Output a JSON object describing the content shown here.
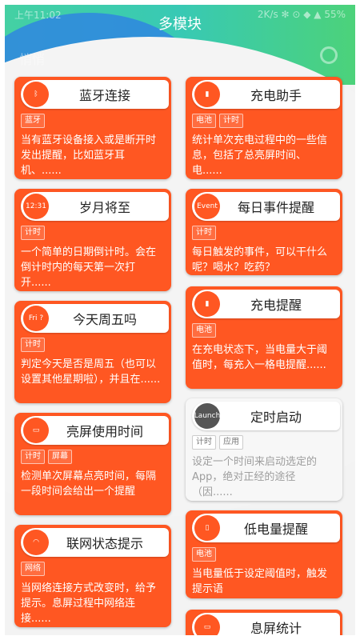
{
  "status_bar": {
    "time": "上午11:02",
    "right": "2K/s ✻ ⊙ ◆ ▲ 55%"
  },
  "header": {
    "title": "多模块",
    "subtitle": "悄悄"
  },
  "colors": {
    "card": "#ff5722",
    "header": "#3ccaa8",
    "blue_curve": "#2f86e0"
  },
  "left_cards": [
    {
      "title": "蓝牙连接",
      "icon": "bluetooth-icon",
      "icon_text": "ᛒ",
      "tags": [
        "蓝牙"
      ],
      "desc": "当有蓝牙设备接入或是断开时发出提醒，比如蓝牙耳机、......"
    },
    {
      "title": "岁月将至",
      "icon": "calendar-icon",
      "icon_text": "12:31",
      "tags": [
        "计时"
      ],
      "desc": "一个简单的日期倒计时。会在倒计时内的每天第一次打开......"
    },
    {
      "title": "今天周五吗",
      "icon": "friday-icon",
      "icon_text": "Fri ?",
      "tags": [
        "计时"
      ],
      "desc": "判定今天是否是周五（也可以设置其他星期啦），并且在......"
    },
    {
      "title": "亮屏使用时间",
      "icon": "screen-time-icon",
      "icon_text": "▭",
      "tags": [
        "计时",
        "屏幕"
      ],
      "desc": "检测单次屏幕点亮时间，每隔一段时间会给出一个提醒"
    },
    {
      "title": "联网状态提示",
      "icon": "wifi-icon",
      "icon_text": "◠",
      "tags": [
        "网络"
      ],
      "desc": "当网络连接方式改变时，给予提示。息屏过程中网络连接......"
    }
  ],
  "right_cards": [
    {
      "title": "充电助手",
      "icon": "battery-icon",
      "icon_text": "▮",
      "tags": [
        "电池",
        "计时"
      ],
      "desc": "统计单次充电过程中的一些信息，包括了总亮屏时间、电......"
    },
    {
      "title": "每日事件提醒",
      "icon": "event-icon",
      "icon_text": "Event",
      "tags": [
        "计时"
      ],
      "desc": "每日触发的事件，可以干什么呢？喝水？吃药？"
    },
    {
      "title": "充电提醒",
      "icon": "charging-icon",
      "icon_text": "▮",
      "tags": [
        "电池"
      ],
      "desc": "在充电状态下，当电量大于阈值时，每充入一格电提醒......"
    },
    {
      "title": "定时启动",
      "icon": "launch-icon",
      "icon_text": "Launch",
      "tags": [
        "计时",
        "应用"
      ],
      "desc": "设定一个时间来启动选定的App，绝对正经的途径（因......",
      "gray": true
    },
    {
      "title": "低电量提醒",
      "icon": "low-battery-icon",
      "icon_text": "▯",
      "tags": [
        "电池"
      ],
      "desc": "当电量低于设定阈值时，触发提示语"
    },
    {
      "title": "息屏统计",
      "icon": "screen-off-icon",
      "icon_text": "▭",
      "tags": [],
      "desc": ""
    }
  ]
}
